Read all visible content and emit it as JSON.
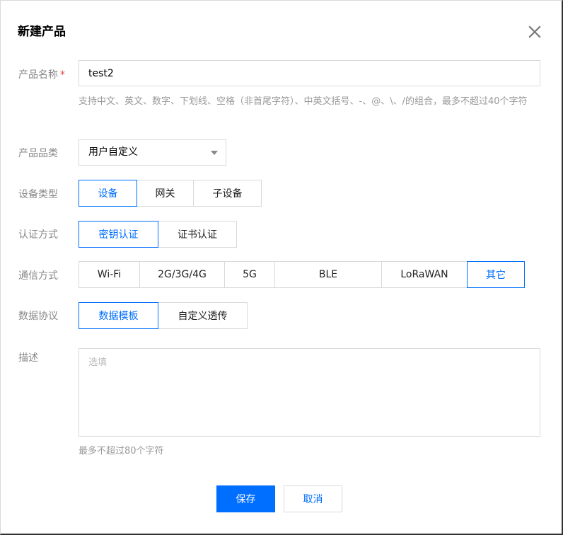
{
  "dialog": {
    "title": "新建产品"
  },
  "form": {
    "product_name": {
      "label": "产品名称",
      "required_mark": "*",
      "value": "test2",
      "hint": "支持中文、英文、数字、下划线、空格（非首尾字符）、中英文括号、-、@、\\、/的组合，最多不超过40个字符"
    },
    "category": {
      "label": "产品品类",
      "selected": "用户自定义"
    },
    "device_type": {
      "label": "设备类型",
      "options": [
        "设备",
        "网关",
        "子设备"
      ],
      "active": 0
    },
    "auth_method": {
      "label": "认证方式",
      "options": [
        "密钥认证",
        "证书认证"
      ],
      "active": 0
    },
    "comm_method": {
      "label": "通信方式",
      "options": [
        "Wi-Fi",
        "2G/3G/4G",
        "5G",
        "BLE",
        "LoRaWAN",
        "其它"
      ],
      "active": 5,
      "info_icon": "info-circle-icon"
    },
    "data_protocol": {
      "label": "数据协议",
      "options": [
        "数据模板",
        "自定义透传"
      ],
      "active": 0
    },
    "description": {
      "label": "描述",
      "placeholder": "选填",
      "value": "",
      "hint": "最多不超过80个字符"
    }
  },
  "footer": {
    "save_label": "保存",
    "cancel_label": "取消"
  },
  "colors": {
    "accent": "#006eff",
    "border": "#d9d9d9",
    "label": "#888888",
    "required": "#e54545"
  }
}
